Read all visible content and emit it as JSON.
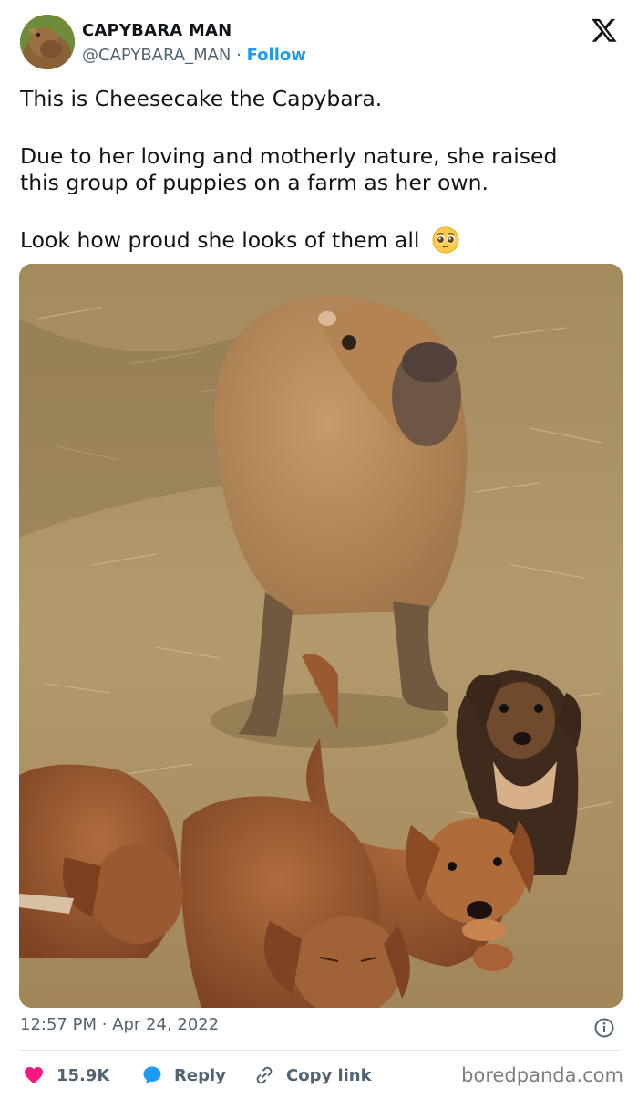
{
  "user": {
    "display_name": "CAPYBARA MAN",
    "handle": "@CAPYBARA_MAN",
    "separator": "·",
    "follow_label": "Follow"
  },
  "tweet": {
    "line1": "This is Cheesecake the Capybara.",
    "line2": "Due to her loving and motherly nature, she raised",
    "line3": "this group of puppies on a farm as her own.",
    "line4": "Look how proud she looks of them all",
    "emoji": "pleading-face-emoji"
  },
  "meta": {
    "time": "12:57 PM",
    "separator": "·",
    "date": "Apr 24, 2022"
  },
  "actions": {
    "likes": "15.9K",
    "reply_label": "Reply",
    "copy_label": "Copy link"
  },
  "watermark": "boredpanda.com",
  "colors": {
    "follow": "#1d9bf0",
    "heart": "#f91880",
    "reply_bubble": "#1d9bf0",
    "secondary_text": "#536471"
  },
  "icons": [
    "x-logo-icon",
    "info-icon",
    "heart-icon",
    "reply-bubble-icon",
    "link-icon"
  ]
}
